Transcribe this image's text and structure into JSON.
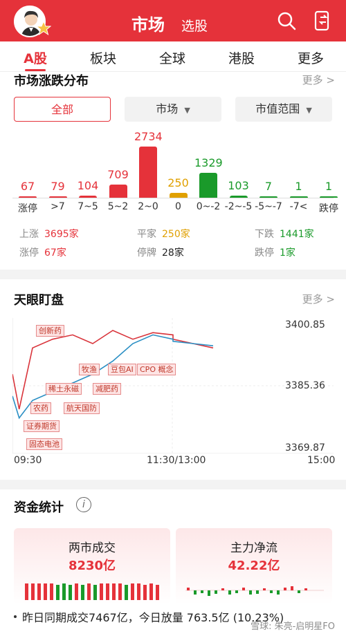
{
  "header": {
    "title": "市场",
    "subtitle": "选股"
  },
  "tabs": [
    {
      "label": "A股"
    },
    {
      "label": "板块"
    },
    {
      "label": "全球"
    },
    {
      "label": "港股"
    },
    {
      "label": "更多"
    }
  ],
  "distribution": {
    "title": "市场涨跌分布",
    "more": "更多 >",
    "filters": [
      "全部",
      "市场",
      "市值范围"
    ],
    "chart_data": {
      "type": "bar",
      "categories": [
        "涨停",
        ">7",
        "7~5",
        "5~2",
        "2~0",
        "0",
        "0~-2",
        "-2~-5",
        "-5~-7",
        "-7<",
        "跌停"
      ],
      "values": [
        67,
        79,
        104,
        709,
        2734,
        250,
        1329,
        103,
        7,
        1,
        1
      ],
      "value_labels": [
        "67",
        "79",
        "104",
        "709",
        "2734",
        "250",
        "1329",
        "103",
        "7",
        "1",
        "1"
      ],
      "colors": [
        "#e5323a",
        "#e5323a",
        "#e5323a",
        "#e5323a",
        "#e5323a",
        "#e0a000",
        "#1a9a2a",
        "#1a9a2a",
        "#1a9a2a",
        "#1a9a2a",
        "#1a9a2a"
      ]
    },
    "stats": {
      "up_label": "上涨",
      "up_value": "3695家",
      "flat_label": "平家",
      "flat_value": "250家",
      "down_label": "下跌",
      "down_value": "1441家",
      "limit_up_label": "涨停",
      "limit_up_value": "67家",
      "suspended_label": "停牌",
      "suspended_value": "28家",
      "limit_down_label": "跌停",
      "limit_down_value": "1家"
    }
  },
  "tianyan": {
    "title": "天眼盯盘",
    "more": "更多 >",
    "y_high": "3400.85",
    "y_mid": "3385.36",
    "y_low": "3369.87",
    "x_start": "09:30",
    "x_mid": "11:30/13:00",
    "x_end": "15:00",
    "tags": [
      "创新药",
      "牧渔",
      "豆包AI",
      "CPO 概念",
      "稀土永磁",
      "减肥药",
      "航天国防",
      "农药",
      "证券期货",
      "固态电池"
    ],
    "chart_data": {
      "type": "line",
      "x_range": [
        "09:30",
        "15:00"
      ],
      "ylim": [
        3369.87,
        3400.85
      ],
      "series": [
        {
          "color": "#d9333a",
          "x": [
            "09:30",
            "09:35",
            "09:45",
            "10:00",
            "10:15",
            "10:30",
            "10:45",
            "11:00",
            "11:15",
            "11:30",
            "13:00",
            "13:15",
            "13:30"
          ],
          "values": [
            3388,
            3380,
            3394,
            3396,
            3397,
            3395,
            3398,
            3396,
            3397.5,
            3397,
            3396,
            3395,
            3394
          ]
        },
        {
          "color": "#2a8fc4",
          "x": [
            "09:30",
            "09:35",
            "09:45",
            "10:00",
            "10:15",
            "10:30",
            "10:45",
            "11:00",
            "11:15",
            "11:30",
            "13:00",
            "13:15",
            "13:30"
          ],
          "values": [
            3383,
            3378,
            3382,
            3384,
            3386,
            3388,
            3391,
            3395,
            3397,
            3396,
            3395.5,
            3395,
            3394.5
          ]
        }
      ]
    }
  },
  "funds": {
    "title": "资金统计",
    "info_icon": "i",
    "turnover_label": "两市成交",
    "turnover_value": "8230亿",
    "main_flow_label": "主力净流",
    "main_flow_value": "42.22亿",
    "footer": "昨日同期成交7467亿，今日放量 763.5亿 (10.23%)",
    "watermark": "雪球: 朱亮-启明星FO"
  }
}
